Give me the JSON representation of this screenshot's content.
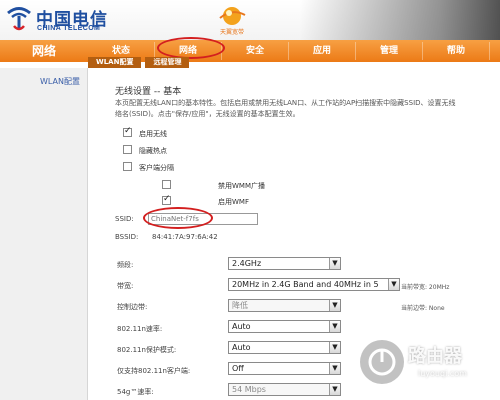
{
  "header": {
    "logo_cn": "中国电信",
    "logo_en": "CHINA TELECOM",
    "brand2_text": "天翼宽带"
  },
  "nav": {
    "section": "网络",
    "tabs": [
      {
        "label": "状态"
      },
      {
        "label": "网络"
      },
      {
        "label": "安全"
      },
      {
        "label": "应用"
      },
      {
        "label": "管理"
      },
      {
        "label": "帮助"
      }
    ],
    "subtabs": [
      {
        "label": "WLAN配置"
      },
      {
        "label": "远程管理"
      }
    ]
  },
  "sidebar": {
    "items": [
      {
        "label": "WLAN配置"
      }
    ]
  },
  "main": {
    "title": "无线设置 -- 基本",
    "desc_line1": "本页配置无线LAN口的基本特性。包括启用或禁用无线LAN口、从工作站的AP扫描搜索中隐藏SSID、设置无线",
    "desc_line2": "络名(SSID)。点击\"保存/应用\"，无线设置的基本配置生效。",
    "checkboxes": {
      "enable_wireless": {
        "label": "启用无线",
        "checked": true
      },
      "hide_ap": {
        "label": "隐藏热点",
        "checked": false
      },
      "client_isolation": {
        "label": "客户端分隔",
        "checked": false
      },
      "disable_wmm": {
        "label": "禁用WMM广播",
        "checked": false
      },
      "enable_wmf": {
        "label": "启用WMF",
        "checked": true
      }
    },
    "ssid": {
      "label": "SSID:",
      "value": "ChinaNet-f7fs"
    },
    "bssid": {
      "label": "BSSID:",
      "value": "84:41:7A:97:6A:42"
    },
    "fields": {
      "band": {
        "label": "频段:",
        "value": "2.4GHz"
      },
      "bandwidth": {
        "label": "带宽:",
        "value": "20MHz in 2.4G Band and 40MHz in 5",
        "note": "当前带宽: 20MHz"
      },
      "control_channel": {
        "label": "控制边带:",
        "value": "降低",
        "note": "当前边带: None"
      },
      "rate_11n": {
        "label": "802.11n速率:",
        "value": "Auto"
      },
      "protection_11n": {
        "label": "802.11n保护模式:",
        "value": "Auto"
      },
      "support_11n_only": {
        "label": "仅支持802.11n客户端:",
        "value": "Off"
      },
      "rate_54g": {
        "label": "54g™速率:",
        "value": "54 Mbps"
      }
    }
  },
  "watermark": {
    "cn": "路由器",
    "en": "luyouqi.com"
  },
  "colors": {
    "nav_orange": "#ec7a16",
    "brand_blue": "#1f4fa0",
    "highlight_red": "#d31f1f"
  }
}
